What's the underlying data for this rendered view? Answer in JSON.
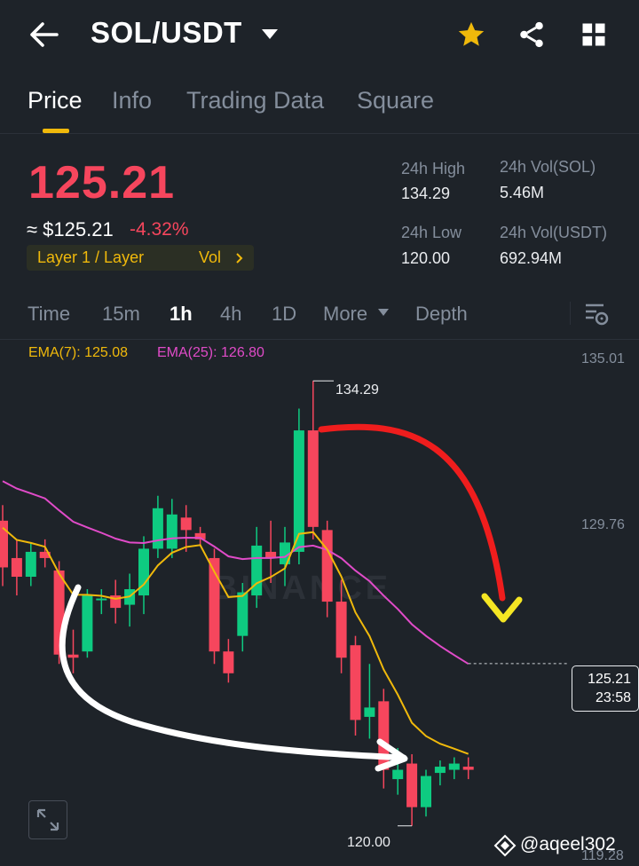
{
  "header": {
    "title": "SOL/USDT"
  },
  "tabs": [
    {
      "label": "Price"
    },
    {
      "label": "Info"
    },
    {
      "label": "Trading Data"
    },
    {
      "label": "Square"
    }
  ],
  "summary": {
    "price": "125.21",
    "usd_price": "≈ $125.21",
    "change": "-4.32%",
    "tag_label": "Layer 1 / Layer",
    "tag_vol": "Vol",
    "high_label": "24h High",
    "high_value": "134.29",
    "low_label": "24h Low",
    "low_value": "120.00",
    "vol_sol_label": "24h Vol(SOL)",
    "vol_sol_value": "5.46M",
    "vol_usdt_label": "24h Vol(USDT)",
    "vol_usdt_value": "692.94M"
  },
  "intervals": [
    {
      "label": "Time"
    },
    {
      "label": "15m"
    },
    {
      "label": "1h"
    },
    {
      "label": "4h"
    },
    {
      "label": "1D"
    },
    {
      "label": "More"
    },
    {
      "label": "Depth"
    }
  ],
  "indicators": {
    "ema7": "EMA(7): 125.08",
    "ema25": "EMA(25): 126.80"
  },
  "colors": {
    "up": "#0ecb81",
    "down": "#f6465d",
    "accent": "#f0b90b",
    "ema7": "#f0b90b",
    "ema25": "#e04bc8"
  },
  "chart": {
    "axis_top": "135.01",
    "axis_mid": "129.76",
    "axis_bottom": "119.28",
    "high_label": "134.29",
    "low_label": "120.00",
    "last_price": "125.21",
    "countdown": "23:58",
    "watermark_text": "BINANCE"
  },
  "chart_data": {
    "type": "candlestick",
    "interval": "1h",
    "ylim": [
      119.28,
      135.01
    ],
    "candles": [
      {
        "o": 129.8,
        "c": 128.3,
        "h": 130.3,
        "l": 127.7
      },
      {
        "o": 128.6,
        "c": 128.0,
        "h": 129.2,
        "l": 127.4
      },
      {
        "o": 128.0,
        "c": 128.8,
        "h": 129.1,
        "l": 127.7
      },
      {
        "o": 128.8,
        "c": 128.6,
        "h": 129.2,
        "l": 128.3
      },
      {
        "o": 128.2,
        "c": 125.5,
        "h": 128.5,
        "l": 125.2
      },
      {
        "o": 125.5,
        "c": 125.4,
        "h": 126.3,
        "l": 124.9
      },
      {
        "o": 125.6,
        "c": 127.4,
        "h": 127.6,
        "l": 125.4
      },
      {
        "o": 127.3,
        "c": 127.3,
        "h": 127.6,
        "l": 126.8
      },
      {
        "o": 127.4,
        "c": 127.0,
        "h": 127.9,
        "l": 126.5
      },
      {
        "o": 127.1,
        "c": 127.6,
        "h": 128.1,
        "l": 126.4
      },
      {
        "o": 127.4,
        "c": 128.9,
        "h": 129.3,
        "l": 126.8
      },
      {
        "o": 128.9,
        "c": 130.2,
        "h": 130.6,
        "l": 128.6
      },
      {
        "o": 128.9,
        "c": 130.0,
        "h": 130.5,
        "l": 128.6
      },
      {
        "o": 129.9,
        "c": 129.5,
        "h": 130.3,
        "l": 128.8
      },
      {
        "o": 129.4,
        "c": 129.2,
        "h": 129.6,
        "l": 129.0
      },
      {
        "o": 128.6,
        "c": 125.6,
        "h": 128.9,
        "l": 125.2
      },
      {
        "o": 125.6,
        "c": 124.9,
        "h": 126.0,
        "l": 124.6
      },
      {
        "o": 126.1,
        "c": 127.5,
        "h": 127.8,
        "l": 125.6
      },
      {
        "o": 127.4,
        "c": 129.0,
        "h": 129.6,
        "l": 127.0
      },
      {
        "o": 128.8,
        "c": 128.6,
        "h": 129.8,
        "l": 127.8
      },
      {
        "o": 128.4,
        "c": 129.1,
        "h": 129.6,
        "l": 127.7
      },
      {
        "o": 128.8,
        "c": 132.7,
        "h": 133.4,
        "l": 128.4
      },
      {
        "o": 132.7,
        "c": 129.6,
        "h": 134.29,
        "l": 129.2
      },
      {
        "o": 129.5,
        "c": 127.2,
        "h": 129.8,
        "l": 126.7
      },
      {
        "o": 127.2,
        "c": 125.4,
        "h": 127.9,
        "l": 124.9
      },
      {
        "o": 125.8,
        "c": 123.4,
        "h": 126.1,
        "l": 122.9
      },
      {
        "o": 123.5,
        "c": 123.8,
        "h": 125.2,
        "l": 122.8
      },
      {
        "o": 124.0,
        "c": 121.8,
        "h": 124.4,
        "l": 121.2
      },
      {
        "o": 121.5,
        "c": 121.8,
        "h": 122.5,
        "l": 121.0
      },
      {
        "o": 122.0,
        "c": 120.6,
        "h": 122.3,
        "l": 120.0
      },
      {
        "o": 120.6,
        "c": 121.6,
        "h": 121.8,
        "l": 120.3
      },
      {
        "o": 121.7,
        "c": 121.9,
        "h": 122.1,
        "l": 121.3
      },
      {
        "o": 121.8,
        "c": 122.0,
        "h": 122.2,
        "l": 121.5
      },
      {
        "o": 121.9,
        "c": 121.8,
        "h": 122.2,
        "l": 121.5
      }
    ]
  }
}
